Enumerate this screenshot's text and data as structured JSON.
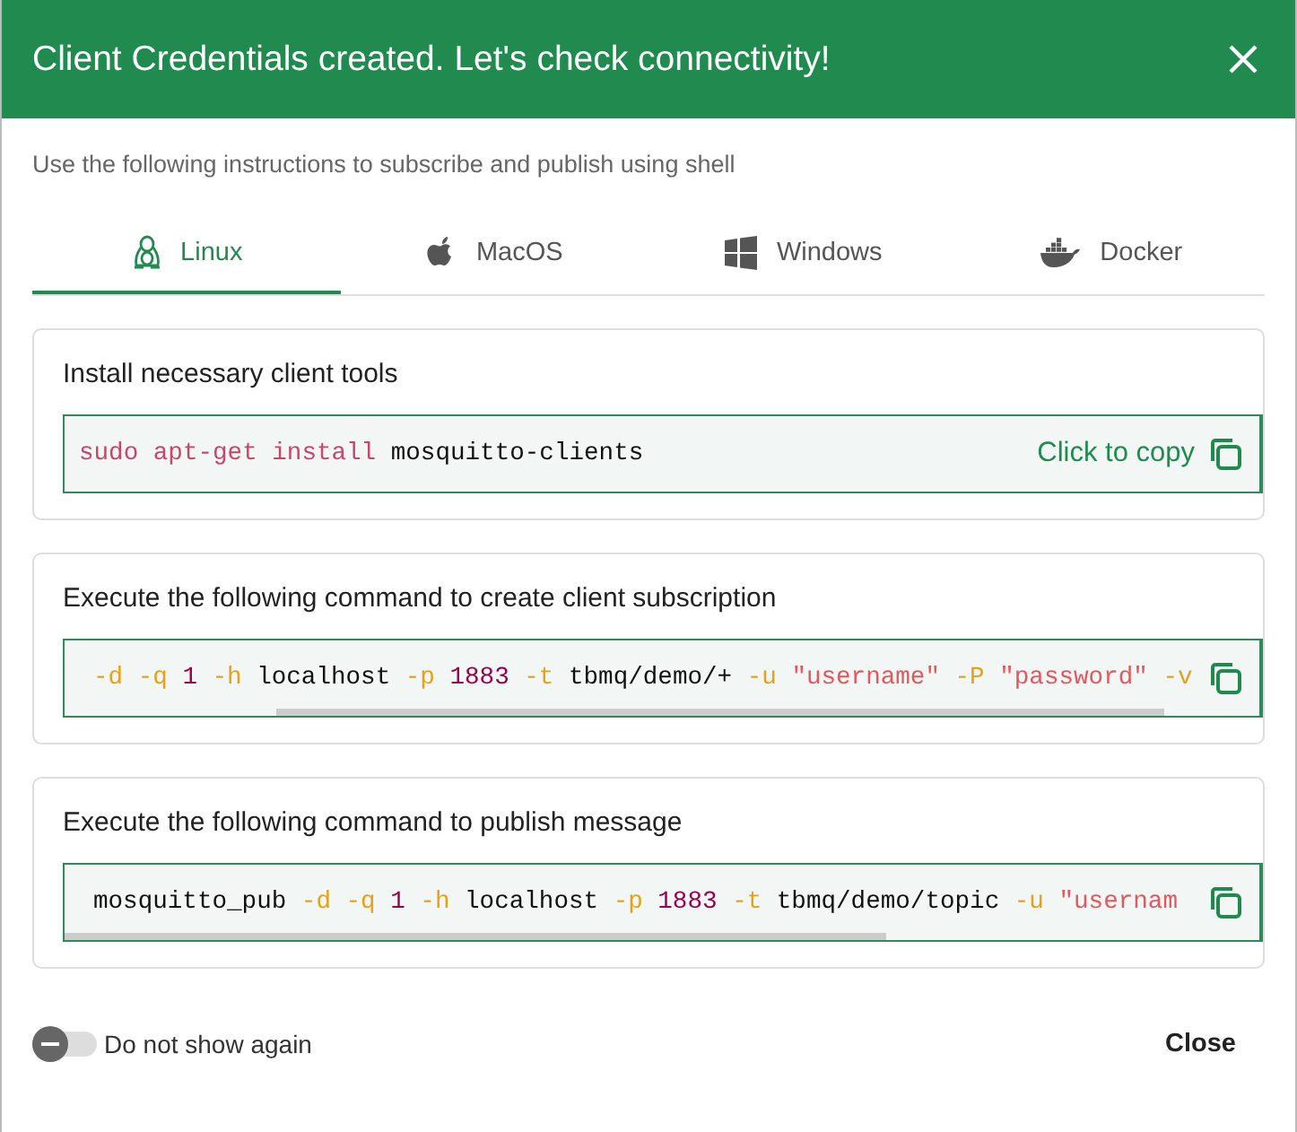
{
  "dialog": {
    "title": "Client Credentials created. Let's check connectivity!",
    "subtitle": "Use the following instructions to subscribe and publish using shell"
  },
  "tabs": [
    {
      "label": "Linux",
      "kind": "linux",
      "selected": true
    },
    {
      "label": "MacOS",
      "kind": "apple",
      "selected": false
    },
    {
      "label": "Windows",
      "kind": "windows",
      "selected": false
    },
    {
      "label": "Docker",
      "kind": "docker",
      "selected": false
    }
  ],
  "steps": [
    {
      "title": "Install necessary client tools",
      "copy_label": "Click to copy",
      "scrollable": false,
      "code": [
        {
          "text": "sudo apt-get install",
          "kind": "command"
        },
        {
          "text": "mosquitto-clients",
          "kind": "plain"
        }
      ]
    },
    {
      "title": "Execute the following command to create client subscription",
      "scrollable": true,
      "code": [
        {
          "text": "-d",
          "kind": "flag"
        },
        {
          "text": "-q",
          "kind": "flag"
        },
        {
          "text": "1",
          "kind": "number"
        },
        {
          "text": "-h",
          "kind": "flag"
        },
        {
          "text": "localhost",
          "kind": "plain"
        },
        {
          "text": "-p",
          "kind": "flag"
        },
        {
          "text": "1883",
          "kind": "number"
        },
        {
          "text": "-t",
          "kind": "flag"
        },
        {
          "text": "tbmq/demo/+",
          "kind": "plain"
        },
        {
          "text": "-u",
          "kind": "flag"
        },
        {
          "text": "\"username\"",
          "kind": "string"
        },
        {
          "text": "-P",
          "kind": "flag"
        },
        {
          "text": "\"password\"",
          "kind": "string"
        },
        {
          "text": "-v",
          "kind": "flag"
        }
      ]
    },
    {
      "title": "Execute the following command to publish message",
      "scrollable": true,
      "code": [
        {
          "text": "mosquitto_pub",
          "kind": "plain"
        },
        {
          "text": "-d",
          "kind": "flag"
        },
        {
          "text": "-q",
          "kind": "flag"
        },
        {
          "text": "1",
          "kind": "number"
        },
        {
          "text": "-h",
          "kind": "flag"
        },
        {
          "text": "localhost",
          "kind": "plain"
        },
        {
          "text": "-p",
          "kind": "flag"
        },
        {
          "text": "1883",
          "kind": "number"
        },
        {
          "text": "-t",
          "kind": "flag"
        },
        {
          "text": "tbmq/demo/topic",
          "kind": "plain"
        },
        {
          "text": "-u",
          "kind": "flag"
        },
        {
          "text": "\"usernam",
          "kind": "string"
        }
      ]
    }
  ],
  "footer": {
    "toggle_label": "Do not show again",
    "toggle_on": false,
    "close_label": "Close"
  }
}
